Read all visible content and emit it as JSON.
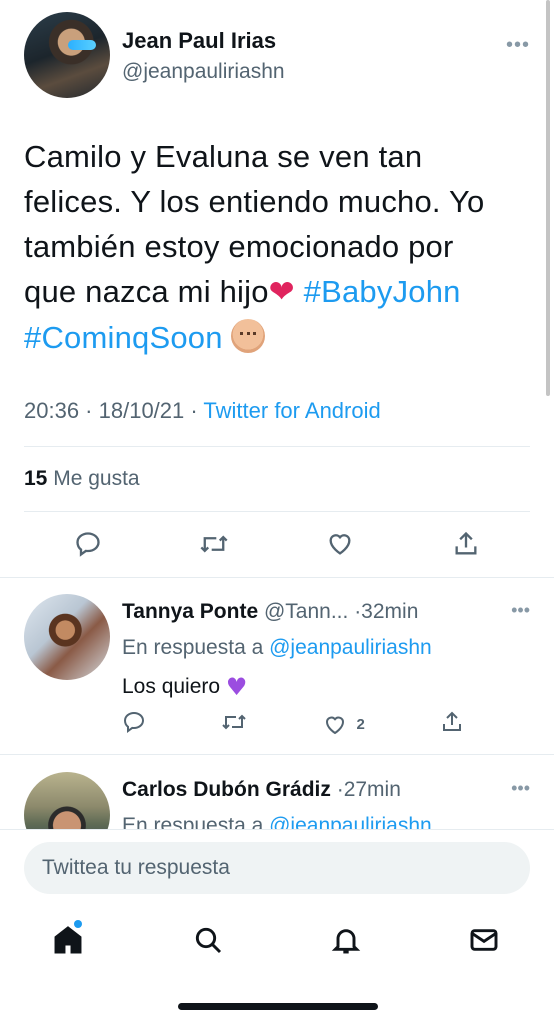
{
  "tweet": {
    "author_name": "Jean Paul Irias",
    "author_handle": "@jeanpauliriashn",
    "more_icon": "more-horizontal-icon",
    "text_line1": "Camilo y Evaluna se ven tan",
    "text_line2": "felices. Y los entiendo mucho. Yo",
    "text_line3": "también estoy emocionado por",
    "text_line4": "que nazca mi hijo",
    "heart_emoji": "❤",
    "hashtag1": "#BabyJohn",
    "hashtag2": "#CominqSoon",
    "time": "20:36",
    "date": "18/10/21",
    "source": "Twitter for Android",
    "likes_count": "15",
    "likes_label": "Me gusta",
    "hashtag_color": "#1d9bf0"
  },
  "replies": [
    {
      "name": "Tannya Ponte",
      "handle": "@Tann...",
      "time": "·32min",
      "in_reply_label": "En respuesta a",
      "mention": "@jeanpauliriashn",
      "text": "Los quiero",
      "like_count": "2"
    },
    {
      "name": "Carlos Dubón Grádiz",
      "time": "·27min",
      "in_reply_label": "En respuesta a",
      "mention": "@jeanpauliriashn"
    }
  ],
  "compose": {
    "placeholder": "Twittea tu respuesta"
  },
  "nav": {
    "items": [
      "home-icon",
      "search-icon",
      "bell-icon",
      "mail-icon"
    ],
    "active": "home-icon"
  }
}
